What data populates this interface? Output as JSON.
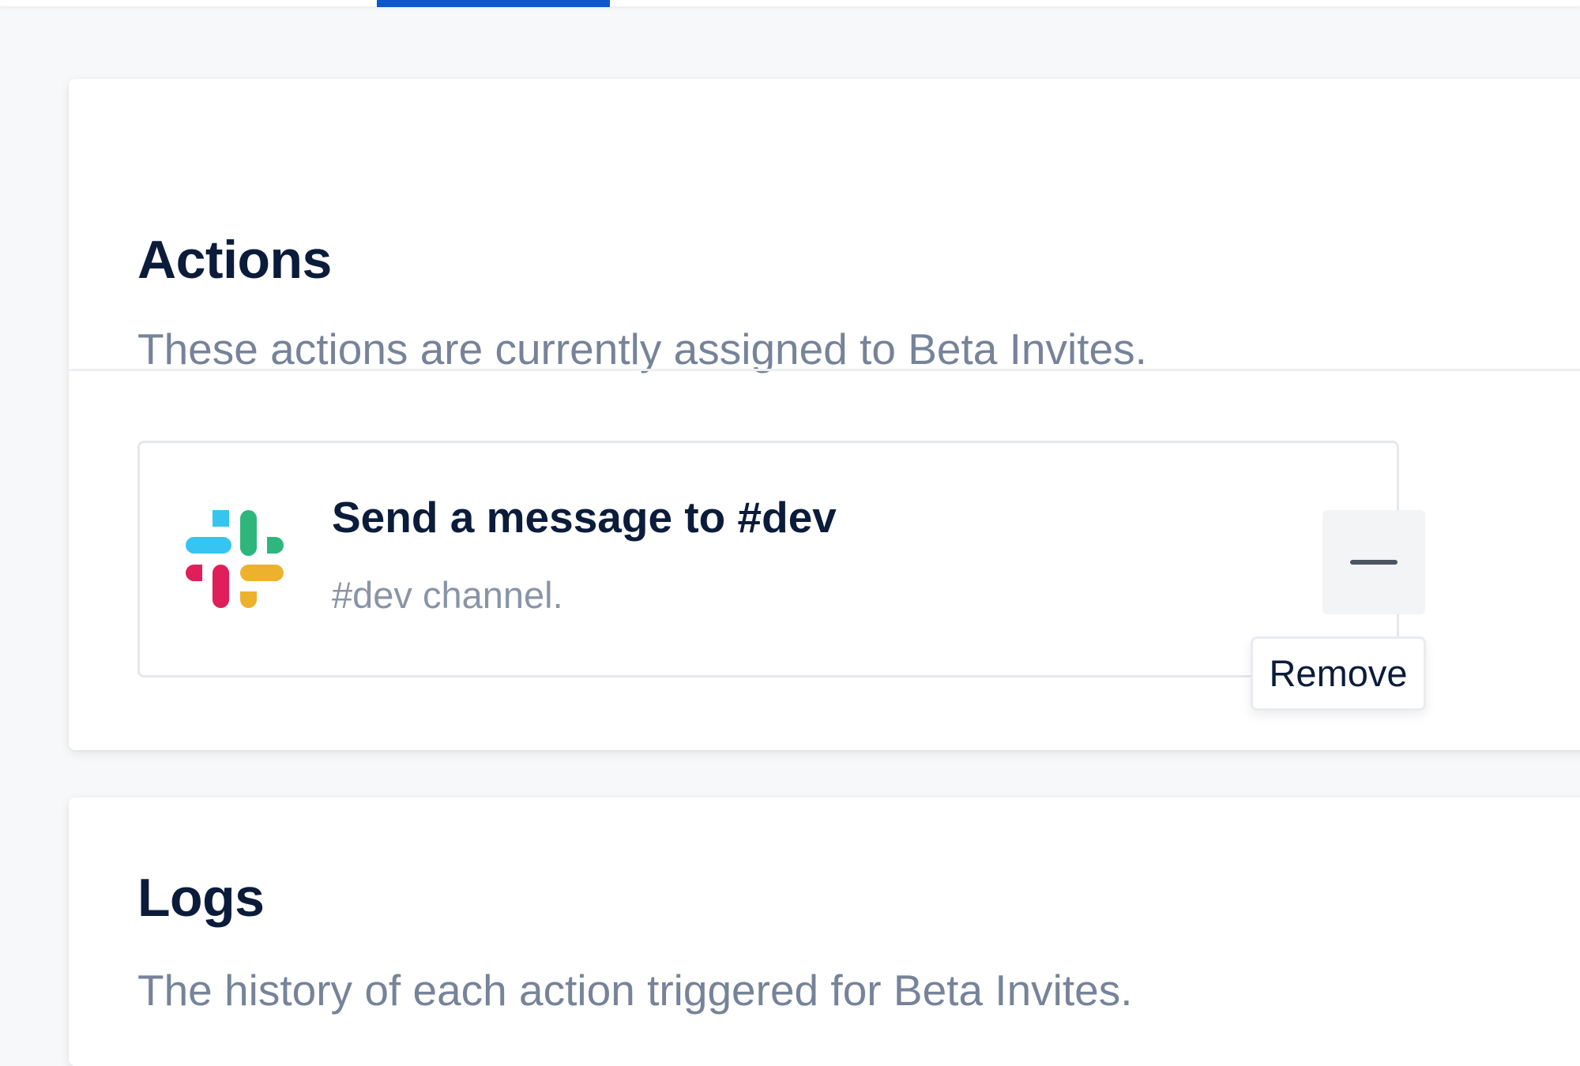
{
  "colors": {
    "accent": "#0b57d0",
    "heading": "#0b1c3b",
    "muted": "#768399",
    "slack_blue": "#36c5f0",
    "slack_green": "#2eb67d",
    "slack_red": "#e01e5a",
    "slack_yellow": "#ecb22e"
  },
  "actions_section": {
    "title": "Actions",
    "description": "These actions are currently assigned to Beta Invites.",
    "items": [
      {
        "icon": "slack-icon",
        "title": "Send a message to #dev",
        "subtitle": "#dev channel.",
        "remove_icon": "minus-icon",
        "remove_tooltip": "Remove"
      }
    ]
  },
  "logs_section": {
    "title": "Logs",
    "description": "The history of each action triggered for Beta Invites."
  }
}
